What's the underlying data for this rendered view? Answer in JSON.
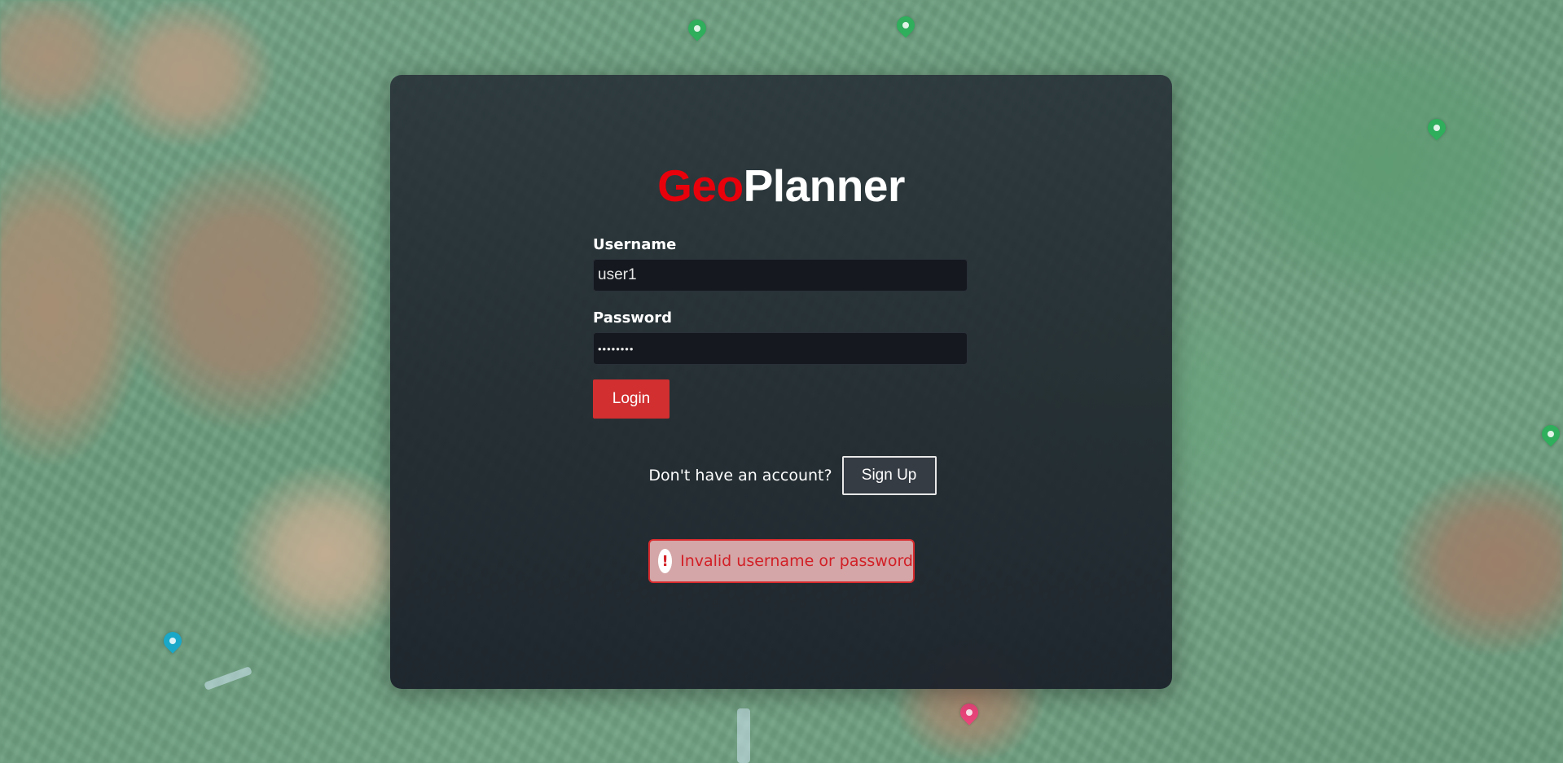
{
  "brand": {
    "part1": "Geo",
    "part2": "Planner",
    "accent_color": "#e8000b"
  },
  "login_form": {
    "username_label": "Username",
    "username_value": "user1",
    "password_label": "Password",
    "password_value": "password",
    "login_label": "Login"
  },
  "signup": {
    "prompt": "Don't have an account?",
    "button_label": "Sign Up"
  },
  "error": {
    "icon_glyph": "!",
    "message": "Invalid username or password",
    "color": "#d21f26"
  },
  "background": {
    "type": "terrain-map",
    "pin_colors": [
      "#2fae5c",
      "#2fae5c",
      "#2fae5c",
      "#2fae5c",
      "#1aa8c8",
      "#e8457a"
    ]
  }
}
